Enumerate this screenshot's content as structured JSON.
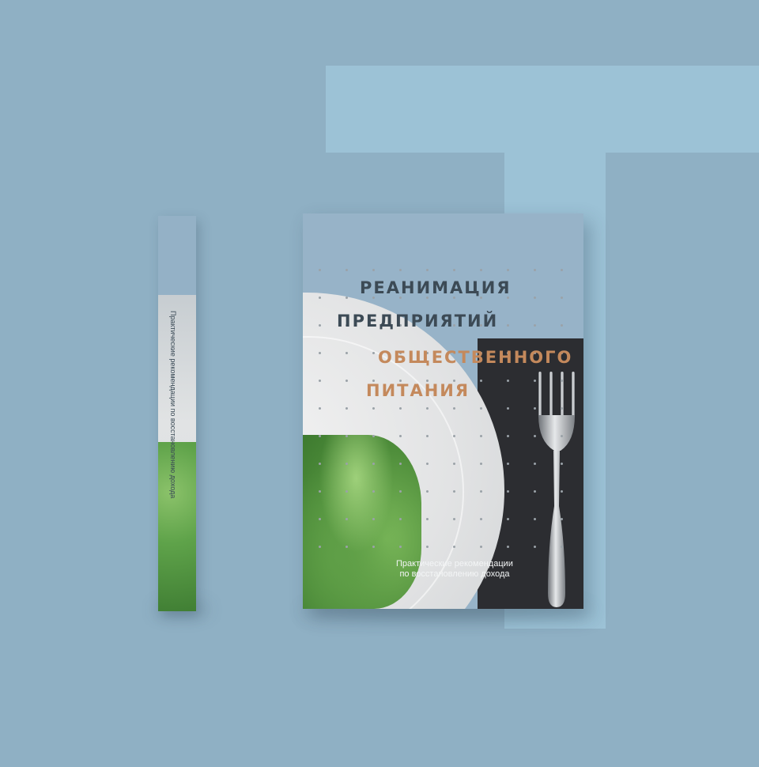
{
  "book": {
    "title_lines": [
      "РЕАНИМАЦИЯ",
      "ПРЕДПРИЯТИЙ",
      "ОБЩЕСТВЕННОГО",
      "ПИТАНИЯ"
    ],
    "subtitle_lines": [
      "Практические рекомендации",
      "по восстановлению дохода"
    ],
    "spine_text": "Практические рекомендации по восстановлению дохода"
  },
  "colors": {
    "background": "#8fb0c4",
    "t_shape": "#9cc2d6",
    "cover_blue": "#97b3c8",
    "dark_panel": "#2c2d31",
    "title_dark": "#3c4a55",
    "title_copper": "#c4895c"
  },
  "icons": {
    "fork": "fork-icon",
    "salad": "lettuce-leaf",
    "plate": "white-plate"
  }
}
